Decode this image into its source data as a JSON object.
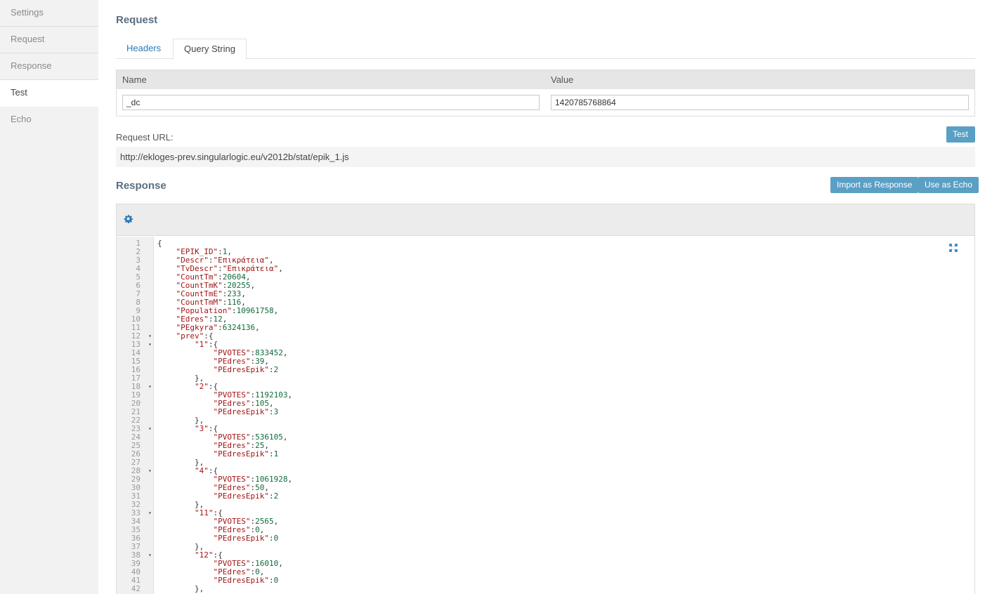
{
  "sidebar": {
    "items": [
      {
        "label": "Settings",
        "active": false
      },
      {
        "label": "Request",
        "active": false
      },
      {
        "label": "Response",
        "active": false
      },
      {
        "label": "Test",
        "active": true
      },
      {
        "label": "Echo",
        "active": false
      }
    ]
  },
  "request": {
    "title": "Request",
    "tabs": [
      {
        "label": "Headers",
        "active": false
      },
      {
        "label": "Query String",
        "active": true
      }
    ],
    "table": {
      "col_name": "Name",
      "col_value": "Value",
      "row": {
        "name": "_dc",
        "value": "1420785768864"
      }
    },
    "url_label": "Request URL:",
    "test_button": "Test",
    "url": "http://ekloges-prev.singularlogic.eu/v2012b/stat/epik_1.js"
  },
  "response": {
    "title": "Response",
    "import_button": "Import as Response",
    "echo_button": "Use as Echo",
    "icons": {
      "settings": "gear-icon",
      "expand": "expand-icon"
    },
    "code_lines": [
      {
        "n": "1",
        "fold": false,
        "text": "{"
      },
      {
        "n": "2",
        "fold": false,
        "text": "    \"EPIK_ID\":1,"
      },
      {
        "n": "3",
        "fold": false,
        "text": "    \"Descr\":\"Επικράτεια\","
      },
      {
        "n": "4",
        "fold": false,
        "text": "    \"TvDescr\":\"Επικράτεια\","
      },
      {
        "n": "5",
        "fold": false,
        "text": "    \"CountTm\":20604,"
      },
      {
        "n": "6",
        "fold": false,
        "text": "    \"CountTmK\":20255,"
      },
      {
        "n": "7",
        "fold": false,
        "text": "    \"CountTmE\":233,"
      },
      {
        "n": "8",
        "fold": false,
        "text": "    \"CountTmM\":116,"
      },
      {
        "n": "9",
        "fold": false,
        "text": "    \"Population\":10961758,"
      },
      {
        "n": "10",
        "fold": false,
        "text": "    \"Edres\":12,"
      },
      {
        "n": "11",
        "fold": false,
        "text": "    \"PEgkyra\":6324136,"
      },
      {
        "n": "12",
        "fold": true,
        "text": "    \"prev\":{"
      },
      {
        "n": "13",
        "fold": true,
        "text": "        \"1\":{"
      },
      {
        "n": "14",
        "fold": false,
        "text": "            \"PVOTES\":833452,"
      },
      {
        "n": "15",
        "fold": false,
        "text": "            \"PEdres\":39,"
      },
      {
        "n": "16",
        "fold": false,
        "text": "            \"PEdresEpik\":2"
      },
      {
        "n": "17",
        "fold": false,
        "text": "        },"
      },
      {
        "n": "18",
        "fold": true,
        "text": "        \"2\":{"
      },
      {
        "n": "19",
        "fold": false,
        "text": "            \"PVOTES\":1192103,"
      },
      {
        "n": "20",
        "fold": false,
        "text": "            \"PEdres\":105,"
      },
      {
        "n": "21",
        "fold": false,
        "text": "            \"PEdresEpik\":3"
      },
      {
        "n": "22",
        "fold": false,
        "text": "        },"
      },
      {
        "n": "23",
        "fold": true,
        "text": "        \"3\":{"
      },
      {
        "n": "24",
        "fold": false,
        "text": "            \"PVOTES\":536105,"
      },
      {
        "n": "25",
        "fold": false,
        "text": "            \"PEdres\":25,"
      },
      {
        "n": "26",
        "fold": false,
        "text": "            \"PEdresEpik\":1"
      },
      {
        "n": "27",
        "fold": false,
        "text": "        },"
      },
      {
        "n": "28",
        "fold": true,
        "text": "        \"4\":{"
      },
      {
        "n": "29",
        "fold": false,
        "text": "            \"PVOTES\":1061928,"
      },
      {
        "n": "30",
        "fold": false,
        "text": "            \"PEdres\":50,"
      },
      {
        "n": "31",
        "fold": false,
        "text": "            \"PEdresEpik\":2"
      },
      {
        "n": "32",
        "fold": false,
        "text": "        },"
      },
      {
        "n": "33",
        "fold": true,
        "text": "        \"11\":{"
      },
      {
        "n": "34",
        "fold": false,
        "text": "            \"PVOTES\":2565,"
      },
      {
        "n": "35",
        "fold": false,
        "text": "            \"PEdres\":0,"
      },
      {
        "n": "36",
        "fold": false,
        "text": "            \"PEdresEpik\":0"
      },
      {
        "n": "37",
        "fold": false,
        "text": "        },"
      },
      {
        "n": "38",
        "fold": true,
        "text": "        \"12\":{"
      },
      {
        "n": "39",
        "fold": false,
        "text": "            \"PVOTES\":16010,"
      },
      {
        "n": "40",
        "fold": false,
        "text": "            \"PEdres\":0,"
      },
      {
        "n": "41",
        "fold": false,
        "text": "            \"PEdresEpik\":0"
      },
      {
        "n": "42",
        "fold": false,
        "text": "        },"
      }
    ]
  }
}
